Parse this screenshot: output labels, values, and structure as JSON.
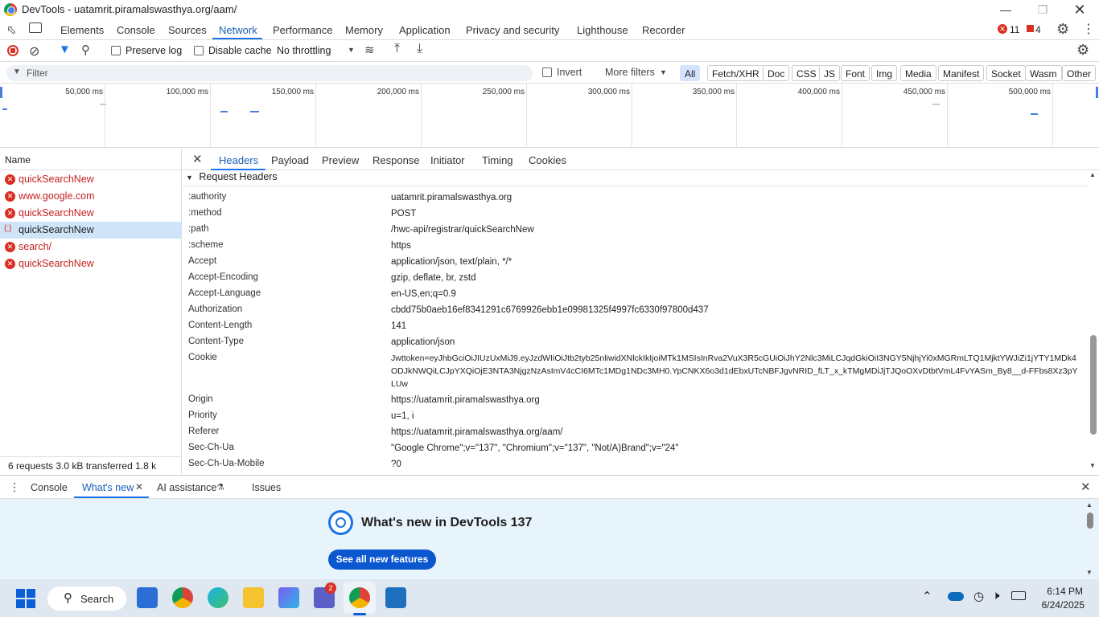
{
  "window": {
    "title": "DevTools - uatamrit.piramalswasthya.org/aam/"
  },
  "panel_tabs": [
    "Elements",
    "Console",
    "Sources",
    "Network",
    "Performance",
    "Memory",
    "Application",
    "Privacy and security",
    "Lighthouse",
    "Recorder"
  ],
  "active_panel": "Network",
  "badges": {
    "errors": "11",
    "warnings": "4"
  },
  "toolbar": {
    "preserve_log": "Preserve log",
    "disable_cache": "Disable cache",
    "throttling": "No throttling"
  },
  "filter": {
    "placeholder": "Filter",
    "invert": "Invert",
    "more_filters": "More filters"
  },
  "filter_chips": [
    "All",
    "Fetch/XHR",
    "Doc",
    "CSS",
    "JS",
    "Font",
    "Img",
    "Media",
    "Manifest",
    "Socket",
    "Wasm",
    "Other"
  ],
  "timeline": {
    "ticks": [
      "50,000 ms",
      "100,000 ms",
      "150,000 ms",
      "200,000 ms",
      "250,000 ms",
      "300,000 ms",
      "350,000 ms",
      "400,000 ms",
      "450,000 ms",
      "500,000 ms"
    ]
  },
  "requests": {
    "header": "Name",
    "items": [
      {
        "name": "quickSearchNew",
        "status": "error"
      },
      {
        "name": "www.google.com",
        "status": "error"
      },
      {
        "name": "quickSearchNew",
        "status": "error"
      },
      {
        "name": "quickSearchNew",
        "status": "selected"
      },
      {
        "name": "search/",
        "status": "error"
      },
      {
        "name": "quickSearchNew",
        "status": "error"
      }
    ],
    "summary": "6 requests    3.0 kB transferred    1.8 k"
  },
  "detail_tabs": [
    "Headers",
    "Payload",
    "Preview",
    "Response",
    "Initiator",
    "Timing",
    "Cookies"
  ],
  "section_title": "Request Headers",
  "headers": [
    {
      "name": ":authority",
      "value": "uatamrit.piramalswasthya.org"
    },
    {
      "name": ":method",
      "value": "POST"
    },
    {
      "name": ":path",
      "value": "/hwc-api/registrar/quickSearchNew"
    },
    {
      "name": ":scheme",
      "value": "https"
    },
    {
      "name": "Accept",
      "value": "application/json, text/plain, */*"
    },
    {
      "name": "Accept-Encoding",
      "value": "gzip, deflate, br, zstd"
    },
    {
      "name": "Accept-Language",
      "value": "en-US,en;q=0.9"
    },
    {
      "name": "Authorization",
      "value": "cbdd75b0aeb16ef8341291c6769926ebb1e09981325f4997fc6330f97800d437"
    },
    {
      "name": "Content-Length",
      "value": "141"
    },
    {
      "name": "Content-Type",
      "value": "application/json"
    },
    {
      "name": "Cookie",
      "value": "Jwttoken=eyJhbGciOiJIUzUxMiJ9.eyJzdWIiOiJtb2tyb25nliwidXNlckIkIjoiMTk1MSIsInRva2VuX3R5cGUiOiJhY2Nlc3MiLCJqdGkiOiI3NGY5NjhjYi0xMGRmLTQ1MjktYWJiZi1jYTY1MDk4ODJkNWQiLCJpYXQiOjE3NTA3NjgzNzAsImV4cCI6MTc1MDg1NDc3MH0.YpCNKX6o3d1dEbxUTcNBFJgvNRID_fLT_x_kTMgMDiJjTJQoOXvDtbtVmL4FvYASm_By8__d-FFbs8Xz3pYLUw"
    },
    {
      "name": "Origin",
      "value": "https://uatamrit.piramalswasthya.org"
    },
    {
      "name": "Priority",
      "value": "u=1, i"
    },
    {
      "name": "Referer",
      "value": "https://uatamrit.piramalswasthya.org/aam/"
    },
    {
      "name": "Sec-Ch-Ua",
      "value": "\"Google Chrome\";v=\"137\", \"Chromium\";v=\"137\", \"Not/A)Brand\";v=\"24\""
    },
    {
      "name": "Sec-Ch-Ua-Mobile",
      "value": "?0"
    }
  ],
  "drawer": {
    "tabs": [
      "Console",
      "What's new",
      "AI assistance",
      "Issues"
    ],
    "active": "What's new",
    "heading": "What's new in DevTools 137",
    "button": "See all new features"
  },
  "taskbar": {
    "search": "Search",
    "teams_badge": "2",
    "time": "6:14 PM",
    "date": "6/24/2025"
  }
}
